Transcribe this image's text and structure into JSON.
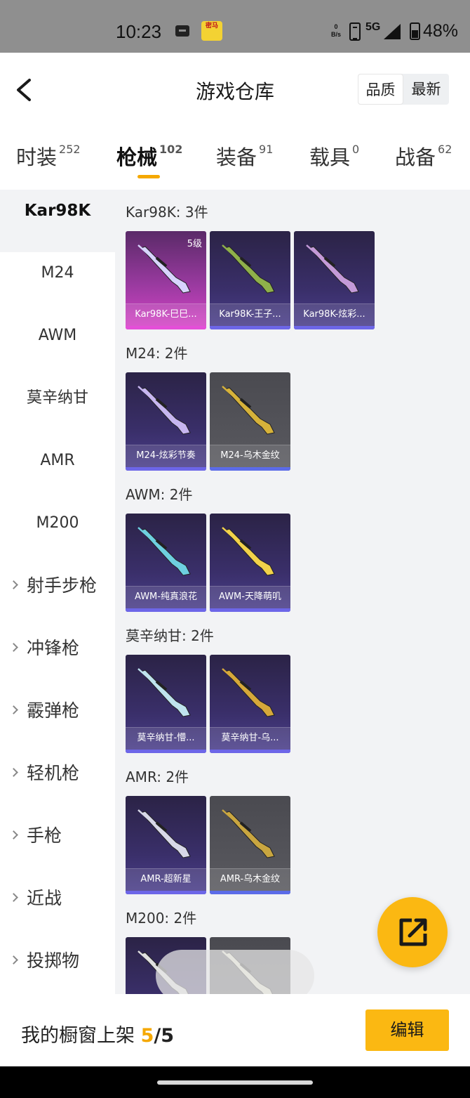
{
  "status": {
    "time": "10:23",
    "net_speed_value": "0",
    "net_speed_unit": "B/s",
    "network": "5G",
    "battery": "48%",
    "app_badge": "密马"
  },
  "header": {
    "title": "游戏仓库",
    "sort_options": [
      "品质",
      "最新"
    ],
    "sort_selected": "品质"
  },
  "tabs": [
    {
      "label": "时装",
      "count": "252"
    },
    {
      "label": "枪械",
      "count": "102",
      "active": true
    },
    {
      "label": "装备",
      "count": "91"
    },
    {
      "label": "载具",
      "count": "0"
    },
    {
      "label": "战备",
      "count": "62"
    }
  ],
  "sidebar": {
    "items": [
      "Kar98K",
      "M24",
      "AWM",
      "莫辛纳甘",
      "AMR",
      "M200"
    ],
    "categories": [
      "射手步枪",
      "冲锋枪",
      "霰弹枪",
      "轻机枪",
      "手枪",
      "近战",
      "投掷物"
    ],
    "active": "Kar98K"
  },
  "groups": [
    {
      "title": "Kar98K: 3件",
      "items": [
        {
          "label": "Kar98K-巳巳...",
          "level": "5级",
          "rarity": "pink",
          "gun_color": "#d8d4ff"
        },
        {
          "label": "Kar98K-王子...",
          "rarity": "purple",
          "gun_color": "#8fb04a"
        },
        {
          "label": "Kar98K-炫彩...",
          "rarity": "purple",
          "gun_color": "#c49ad8"
        }
      ]
    },
    {
      "title": "M24: 2件",
      "items": [
        {
          "label": "M24-炫彩节奏",
          "rarity": "purple",
          "gun_color": "#c7b6f0"
        },
        {
          "label": "M24-乌木金纹",
          "rarity": "grey",
          "gun_color": "#d6b23a"
        }
      ]
    },
    {
      "title": "AWM: 2件",
      "items": [
        {
          "label": "AWM-纯真浪花",
          "rarity": "purple",
          "gun_color": "#6ed0e0"
        },
        {
          "label": "AWM-天降萌叽",
          "rarity": "purple",
          "gun_color": "#f2d24a"
        }
      ]
    },
    {
      "title": "莫辛纳甘: 2件",
      "items": [
        {
          "label": "莫辛纳甘-懵...",
          "rarity": "purple",
          "gun_color": "#bfe3ee"
        },
        {
          "label": "莫辛纳甘-乌...",
          "rarity": "purple",
          "gun_color": "#d6a83a"
        }
      ]
    },
    {
      "title": "AMR: 2件",
      "items": [
        {
          "label": "AMR-超新星",
          "rarity": "purple",
          "gun_color": "#d8d8e8"
        },
        {
          "label": "AMR-乌木金纹",
          "rarity": "grey",
          "gun_color": "#c9a640"
        }
      ]
    },
    {
      "title": "M200: 2件",
      "items": [
        {
          "label": "",
          "rarity": "purple",
          "gun_color": "#e0e0e0"
        },
        {
          "label": "",
          "rarity": "grey",
          "gun_color": "#e8e6d0"
        }
      ]
    }
  ],
  "bottom": {
    "label": "我的橱窗上架",
    "current": "5",
    "separator": "/",
    "total": "5",
    "edit_label": "编辑"
  },
  "colors": {
    "accent": "#fbb812",
    "tab_underline": "#f5a800"
  }
}
